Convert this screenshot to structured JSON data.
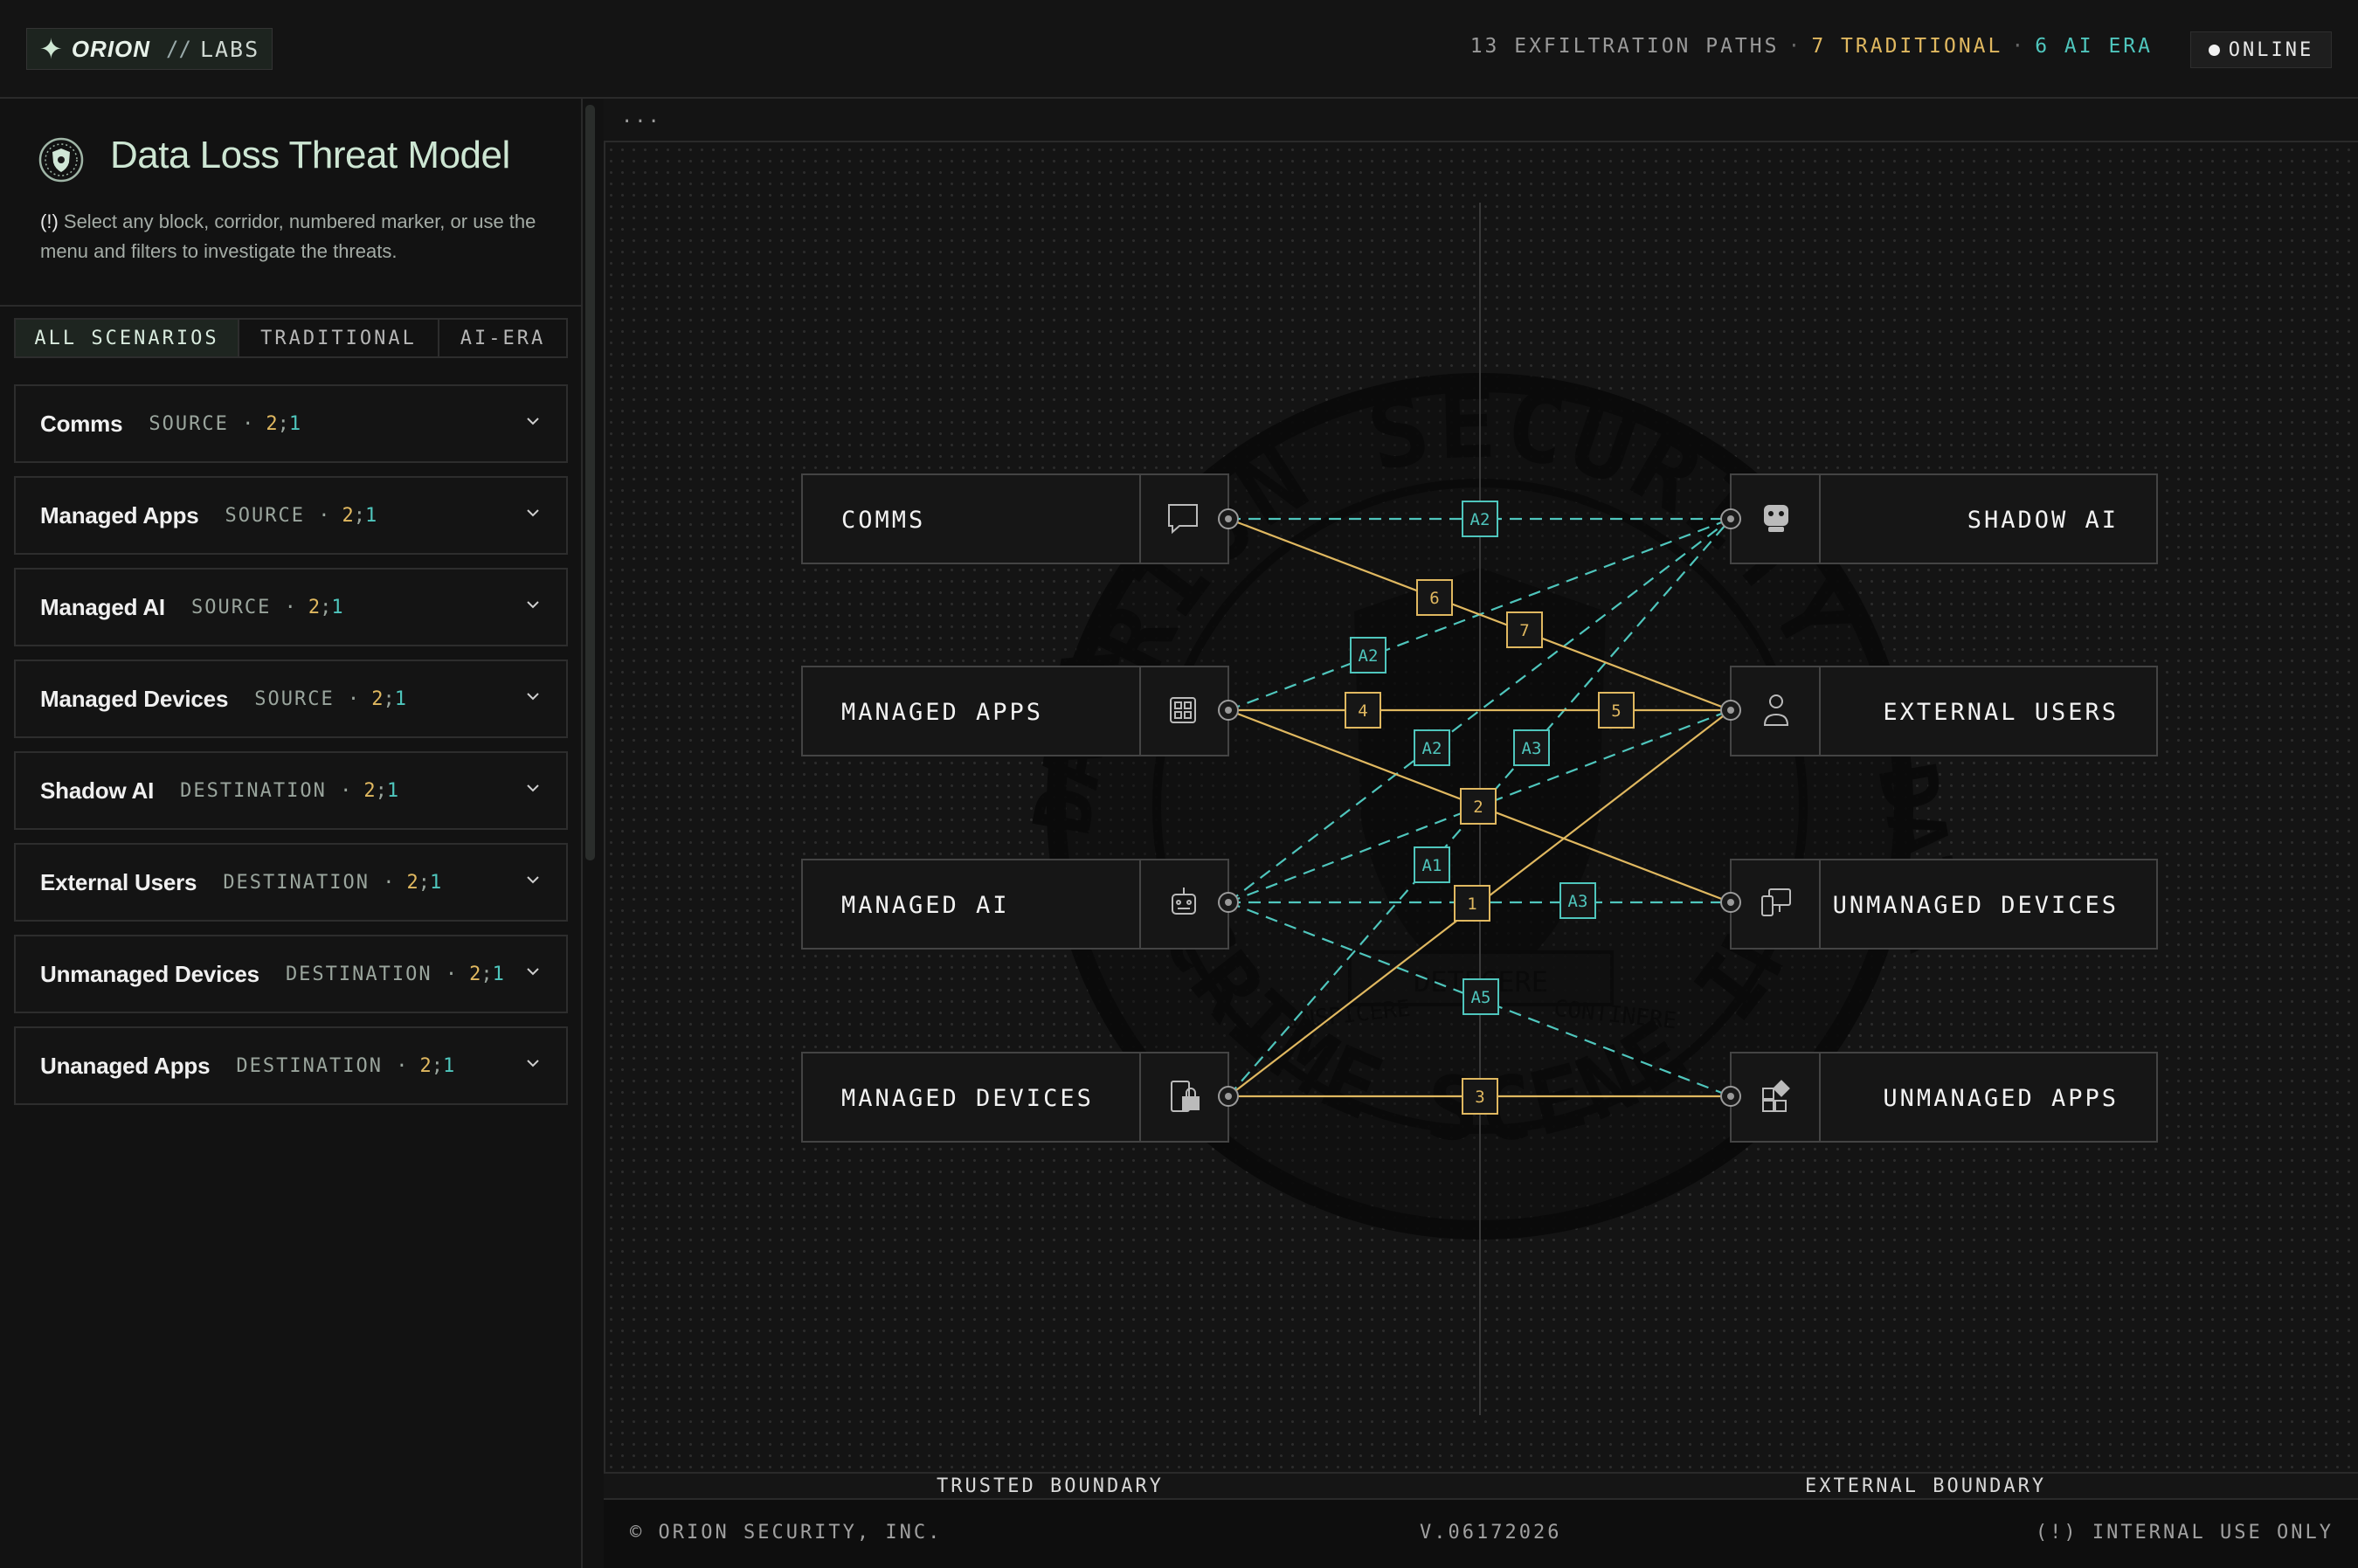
{
  "app": {
    "brand": "ORION",
    "separator": "//",
    "section": "LABS"
  },
  "header": {
    "stats": {
      "paths": "13 EXFILTRATION PATHS",
      "traditional": "7 TRADITIONAL",
      "ai_era": "6 AI ERA"
    },
    "status": "ONLINE"
  },
  "sidebar": {
    "title": "Data Loss Threat Model",
    "hint_prefix": "(!)",
    "hint": "Select any block, corridor, numbered marker, or use the menu and filters to investigate the threats.",
    "tabs": [
      {
        "label": "ALL SCENARIOS",
        "active": true
      },
      {
        "label": "TRADITIONAL",
        "active": false
      },
      {
        "label": "AI-ERA",
        "active": false
      }
    ],
    "items": [
      {
        "name": "Comms",
        "role": "SOURCE",
        "trad": "2",
        "ai": "1"
      },
      {
        "name": "Managed Apps",
        "role": "SOURCE",
        "trad": "2",
        "ai": "1"
      },
      {
        "name": "Managed AI",
        "role": "SOURCE",
        "trad": "2",
        "ai": "1"
      },
      {
        "name": "Managed Devices",
        "role": "SOURCE",
        "trad": "2",
        "ai": "1"
      },
      {
        "name": "Shadow AI",
        "role": "DESTINATION",
        "trad": "2",
        "ai": "1"
      },
      {
        "name": "External Users",
        "role": "DESTINATION",
        "trad": "2",
        "ai": "1"
      },
      {
        "name": "Unmanaged Devices",
        "role": "DESTINATION",
        "trad": "2",
        "ai": "1"
      },
      {
        "name": "Unanaged Apps",
        "role": "DESTINATION",
        "trad": "2",
        "ai": "1"
      }
    ]
  },
  "canvas": {
    "toolbar_dots": "...",
    "sources": [
      "COMMS",
      "MANAGED APPS",
      "MANAGED AI",
      "MANAGED DEVICES"
    ],
    "destinations": [
      "SHADOW AI",
      "EXTERNAL USERS",
      "UNMANAGED DEVICES",
      "UNMANAGED APPS"
    ],
    "source_icons": [
      "chat-icon",
      "apps-grid-icon",
      "robot-icon",
      "device-lock-icon"
    ],
    "destination_icons": [
      "ghost-bot-icon",
      "user-icon",
      "devices-icon",
      "apps-add-icon"
    ],
    "markers_traditional": [
      "1",
      "2",
      "3",
      "4",
      "5",
      "6",
      "7"
    ],
    "markers_ai": [
      "A1",
      "A2",
      "A2",
      "A2",
      "A3",
      "A3",
      "A5"
    ],
    "watermark": {
      "arc_top": "ORION SECURITY",
      "arc_bottom": "CRIME SCENE INVESTI",
      "left": "DATA",
      "right": "DATA",
      "ribbon_left": "INSPICERE",
      "ribbon_center": "DETEGERE",
      "ribbon_right": "CONTINERE"
    },
    "colors": {
      "traditional": "#e0b860",
      "ai": "#4fc6bd"
    }
  },
  "boundaries": {
    "trusted": "TRUSTED BOUNDARY",
    "external": "EXTERNAL BOUNDARY"
  },
  "footer": {
    "copyright": "© ORION SECURITY, INC.",
    "version": "V.06172026",
    "notice": "(!) INTERNAL USE ONLY"
  }
}
